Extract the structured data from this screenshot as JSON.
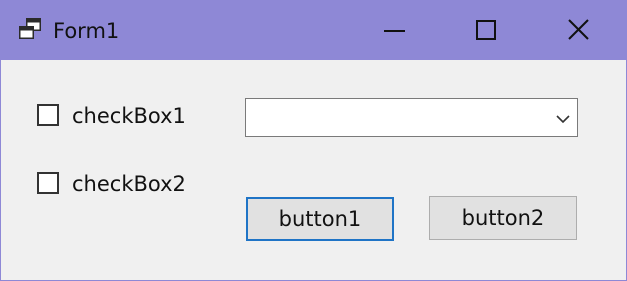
{
  "window": {
    "title": "Form1",
    "app_icon": "form-window-icon",
    "controls": {
      "minimize_icon": "minimize-icon",
      "maximize_icon": "maximize-icon",
      "close_icon": "close-icon"
    },
    "colors": {
      "titlebar": "#8e88d6",
      "client_bg": "#f0f0f0",
      "focused_button_border": "#1f74c6"
    }
  },
  "form": {
    "checkbox1": {
      "label": "checkBox1",
      "checked": false
    },
    "checkbox2": {
      "label": "checkBox2",
      "checked": false
    },
    "combobox": {
      "value": "",
      "icon": "chevron-down-icon"
    },
    "button1": {
      "label": "button1"
    },
    "button2": {
      "label": "button2"
    }
  }
}
